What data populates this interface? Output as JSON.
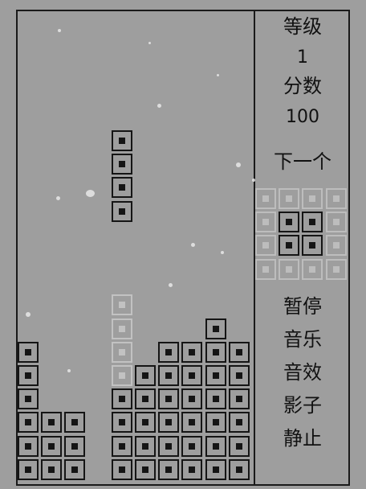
{
  "colors": {
    "background": "#9e9e9e",
    "block": "#151515",
    "ghost": "#c2c2c2",
    "empty_preview": "#bdbdbd"
  },
  "side_panel": {
    "level_label": "等级",
    "level_value": "1",
    "score_label": "分数",
    "score_value": "100",
    "next_label": "下一个",
    "pause_button": "暂停",
    "music_button": "音乐",
    "sound_button": "音效",
    "shadow_button": "影子",
    "stop_button": "静止"
  },
  "next_piece": {
    "shape": "O",
    "grid": [
      [
        0,
        0,
        0,
        0
      ],
      [
        0,
        1,
        1,
        0
      ],
      [
        0,
        1,
        1,
        0
      ],
      [
        0,
        0,
        0,
        0
      ]
    ]
  },
  "active_piece": {
    "shape": "I",
    "cells": [
      [
        4,
        5
      ],
      [
        4,
        6
      ],
      [
        4,
        7
      ],
      [
        4,
        8
      ]
    ]
  },
  "ghost_piece": {
    "cells": [
      [
        4,
        12
      ],
      [
        4,
        13
      ],
      [
        4,
        14
      ],
      [
        4,
        15
      ]
    ]
  },
  "stack_cells": [
    [
      8,
      13
    ],
    [
      6,
      14
    ],
    [
      7,
      14
    ],
    [
      8,
      14
    ],
    [
      9,
      14
    ],
    [
      5,
      15
    ],
    [
      6,
      15
    ],
    [
      7,
      15
    ],
    [
      8,
      15
    ],
    [
      9,
      15
    ],
    [
      0,
      14
    ],
    [
      0,
      15
    ],
    [
      0,
      16
    ],
    [
      0,
      17
    ],
    [
      1,
      17
    ],
    [
      2,
      17
    ],
    [
      0,
      18
    ],
    [
      1,
      18
    ],
    [
      2,
      18
    ],
    [
      0,
      19
    ],
    [
      1,
      19
    ],
    [
      2,
      19
    ],
    [
      4,
      16
    ],
    [
      5,
      16
    ],
    [
      6,
      16
    ],
    [
      7,
      16
    ],
    [
      8,
      16
    ],
    [
      9,
      16
    ],
    [
      4,
      17
    ],
    [
      5,
      17
    ],
    [
      6,
      17
    ],
    [
      7,
      17
    ],
    [
      8,
      17
    ],
    [
      9,
      17
    ],
    [
      4,
      18
    ],
    [
      5,
      18
    ],
    [
      6,
      18
    ],
    [
      7,
      18
    ],
    [
      8,
      18
    ],
    [
      9,
      18
    ],
    [
      4,
      19
    ],
    [
      5,
      19
    ],
    [
      6,
      19
    ],
    [
      7,
      19
    ],
    [
      8,
      19
    ],
    [
      9,
      19
    ]
  ]
}
